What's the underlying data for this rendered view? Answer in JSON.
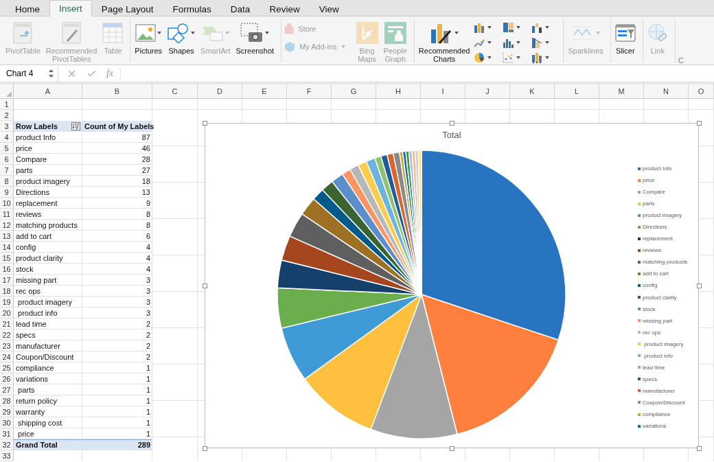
{
  "tabs": [
    {
      "label": "Home",
      "selected": false
    },
    {
      "label": "Insert",
      "selected": true
    },
    {
      "label": "Page Layout",
      "selected": false
    },
    {
      "label": "Formulas",
      "selected": false
    },
    {
      "label": "Data",
      "selected": false
    },
    {
      "label": "Review",
      "selected": false
    },
    {
      "label": "View",
      "selected": false
    }
  ],
  "ribbon": {
    "groups": [
      {
        "items": [
          {
            "kind": "large",
            "label": "PivotTable",
            "disabled": true,
            "dropdown": false
          },
          {
            "kind": "large",
            "label": "Recommended PivotTables",
            "disabled": true,
            "dropdown": false
          },
          {
            "kind": "large",
            "label": "Table",
            "disabled": true,
            "dropdown": false
          }
        ]
      },
      {
        "items": [
          {
            "kind": "large",
            "label": "Pictures",
            "disabled": false,
            "dropdown": true
          },
          {
            "kind": "large",
            "label": "Shapes",
            "disabled": false,
            "dropdown": true
          },
          {
            "kind": "large",
            "label": "SmartArt",
            "disabled": true,
            "dropdown": true
          },
          {
            "kind": "large",
            "label": "Screenshot",
            "disabled": false,
            "dropdown": true
          }
        ]
      },
      {
        "items": [
          {
            "kind": "small_stack",
            "items": [
              {
                "label": "Store",
                "disabled": true,
                "dropdown": false
              },
              {
                "label": "My Add-ins",
                "disabled": true,
                "dropdown": true
              }
            ]
          },
          {
            "kind": "large",
            "label": "Bing Maps",
            "disabled": true,
            "dropdown": false
          },
          {
            "kind": "large",
            "label": "People Graph",
            "disabled": true,
            "dropdown": false
          }
        ]
      },
      {
        "items": [
          {
            "kind": "large",
            "label": "Recommended Charts",
            "disabled": false,
            "dropdown": true
          },
          {
            "kind": "chart_gallery"
          }
        ]
      },
      {
        "items": [
          {
            "kind": "large",
            "label": "Sparklines",
            "disabled": true,
            "dropdown": true
          }
        ]
      },
      {
        "items": [
          {
            "kind": "large",
            "label": "Slicer",
            "disabled": false,
            "dropdown": false
          }
        ]
      },
      {
        "items": [
          {
            "kind": "large",
            "label": "Link",
            "disabled": true,
            "dropdown": false
          }
        ]
      },
      {
        "items": [
          {
            "kind": "partial",
            "label": "C",
            "disabled": true
          }
        ]
      }
    ]
  },
  "formula_bar": {
    "name_box": "Chart 4",
    "function_symbol": "fx"
  },
  "columns": [
    "A",
    "B",
    "C",
    "D",
    "E",
    "F",
    "G",
    "H",
    "I",
    "J",
    "K",
    "L",
    "M",
    "N",
    "O"
  ],
  "rows": [
    "1",
    "2",
    "3",
    "4",
    "5",
    "6",
    "7",
    "8",
    "9",
    "10",
    "11",
    "12",
    "13",
    "14",
    "15",
    "16",
    "17",
    "18",
    "19",
    "20",
    "21",
    "22",
    "23",
    "24",
    "25",
    "26",
    "27",
    "28",
    "29",
    "30",
    "31",
    "32",
    "33"
  ],
  "pivot": {
    "header_label": "Row Labels",
    "header_value": "Count of My Labels",
    "rows": [
      {
        "label": "product Info",
        "count": "87"
      },
      {
        "label": "price",
        "count": "46"
      },
      {
        "label": "Compare",
        "count": "28"
      },
      {
        "label": "parts",
        "count": "27"
      },
      {
        "label": "product imagery",
        "count": "18"
      },
      {
        "label": "Directions",
        "count": "13"
      },
      {
        "label": "replacement",
        "count": "9"
      },
      {
        "label": "reviews",
        "count": "8"
      },
      {
        "label": "matching products",
        "count": "8"
      },
      {
        "label": "add to cart",
        "count": "6"
      },
      {
        "label": "config",
        "count": "4"
      },
      {
        "label": "product clarity",
        "count": "4"
      },
      {
        "label": "stock",
        "count": "4"
      },
      {
        "label": "missing part",
        "count": "3"
      },
      {
        "label": "rec ops",
        "count": "3"
      },
      {
        "label": " product imagery",
        "count": "3"
      },
      {
        "label": " product info",
        "count": "3"
      },
      {
        "label": "lead time",
        "count": "2"
      },
      {
        "label": "specs",
        "count": "2"
      },
      {
        "label": "manufacturer",
        "count": "2"
      },
      {
        "label": "Coupon/Discount",
        "count": "2"
      },
      {
        "label": "compliance",
        "count": "1"
      },
      {
        "label": "variations",
        "count": "1"
      },
      {
        "label": " parts",
        "count": "1"
      },
      {
        "label": "return policy",
        "count": "1"
      },
      {
        "label": "warranty",
        "count": "1"
      },
      {
        "label": " shipping cost",
        "count": "1"
      },
      {
        "label": " price",
        "count": "1"
      }
    ],
    "total_label": "Grand Total",
    "total_value": "289"
  },
  "chart": {
    "selected": true,
    "chart_data": {
      "type": "pie",
      "title": "Total",
      "categories": [
        "product Info",
        "price",
        "Compare",
        "parts",
        "product imagery",
        "Directions",
        "replacement",
        "reviews",
        "matching products",
        "add to cart",
        "config",
        "product clarity",
        "stock",
        "missing part",
        "rec ops",
        " product imagery",
        " product info",
        "lead time",
        "specs",
        "manufacturer",
        "Coupon/Discount",
        "compliance",
        "variations",
        null,
        null,
        null,
        null,
        null
      ],
      "series": [
        {
          "values": [
            30.1,
            15.9,
            9.7,
            9.3,
            6.2,
            4.5,
            3.1,
            2.8,
            2.8,
            2.1,
            1.4,
            1.4,
            1.4,
            1.0,
            1.0,
            1.0,
            1.0,
            0.7,
            0.7,
            0.7,
            0.7,
            0.35,
            0.35,
            0.35,
            0.35,
            0.35,
            0.35,
            0.35
          ]
        }
      ],
      "colors": [
        "#2874c0",
        "#ff7f3f",
        "#a5a5a5",
        "#ffc03f",
        "#3e9bd5",
        "#6aae4e",
        "#16406c",
        "#a5461e",
        "#5f5f5f",
        "#9e7023",
        "#005b8a",
        "#3a6531",
        "#5a8fcc",
        "#ff9462",
        "#b7b7b7",
        "#ffcd4d",
        "#6cb3df",
        "#8cc36c",
        "#1f5c9a",
        "#e0612b",
        "#8a8a8a",
        "#d4a028",
        "#0070b8",
        "#4f8f3a",
        "#9ec1e8",
        "#ffb38a",
        "#cfcfcf",
        "#ffe08a"
      ]
    }
  }
}
